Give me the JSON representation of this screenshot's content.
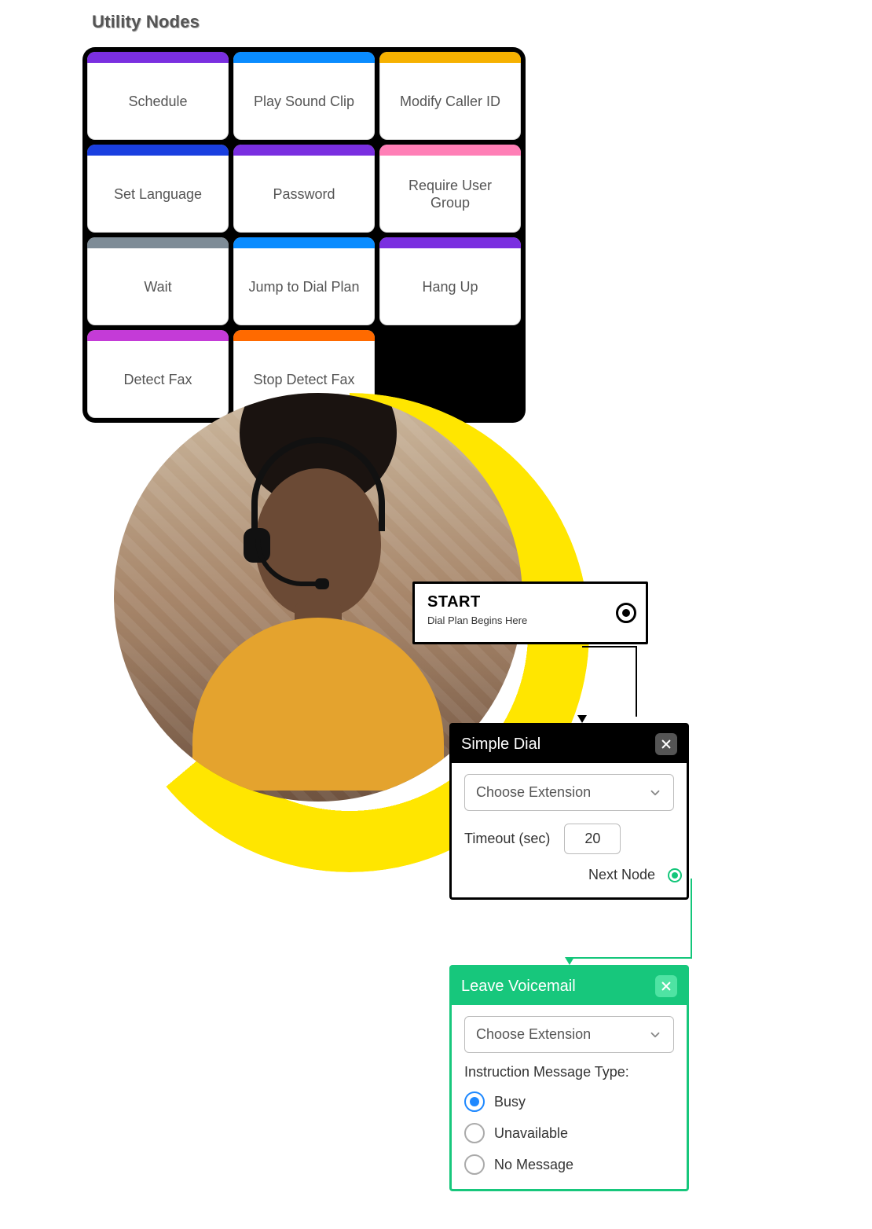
{
  "header": {
    "title": "Utility Nodes"
  },
  "nodes": [
    {
      "label": "Schedule",
      "color": "#7a2fe0"
    },
    {
      "label": "Play Sound Clip",
      "color": "#0a8cff"
    },
    {
      "label": "Modify Caller ID",
      "color": "#f6b100"
    },
    {
      "label": "Set Language",
      "color": "#1a3fe0"
    },
    {
      "label": "Password",
      "color": "#7a2fe0"
    },
    {
      "label": "Require User Group",
      "color": "#ff7fb6"
    },
    {
      "label": "Wait",
      "color": "#7e8c97"
    },
    {
      "label": "Jump to Dial Plan",
      "color": "#0a8cff"
    },
    {
      "label": "Hang Up",
      "color": "#7a2fe0"
    },
    {
      "label": "Detect Fax",
      "color": "#c43bd7"
    },
    {
      "label": "Stop Detect Fax",
      "color": "#ff6a00"
    }
  ],
  "start": {
    "title": "START",
    "subtitle": "Dial Plan Begins Here"
  },
  "simpleDial": {
    "title": "Simple Dial",
    "extension_placeholder": "Choose Extension",
    "timeout_label": "Timeout (sec)",
    "timeout_value": "20",
    "next_label": "Next Node"
  },
  "voicemail": {
    "title": "Leave Voicemail",
    "extension_placeholder": "Choose Extension",
    "instruction_label": "Instruction Message Type:",
    "options": [
      "Busy",
      "Unavailable",
      "No Message"
    ],
    "selected": "Busy"
  }
}
